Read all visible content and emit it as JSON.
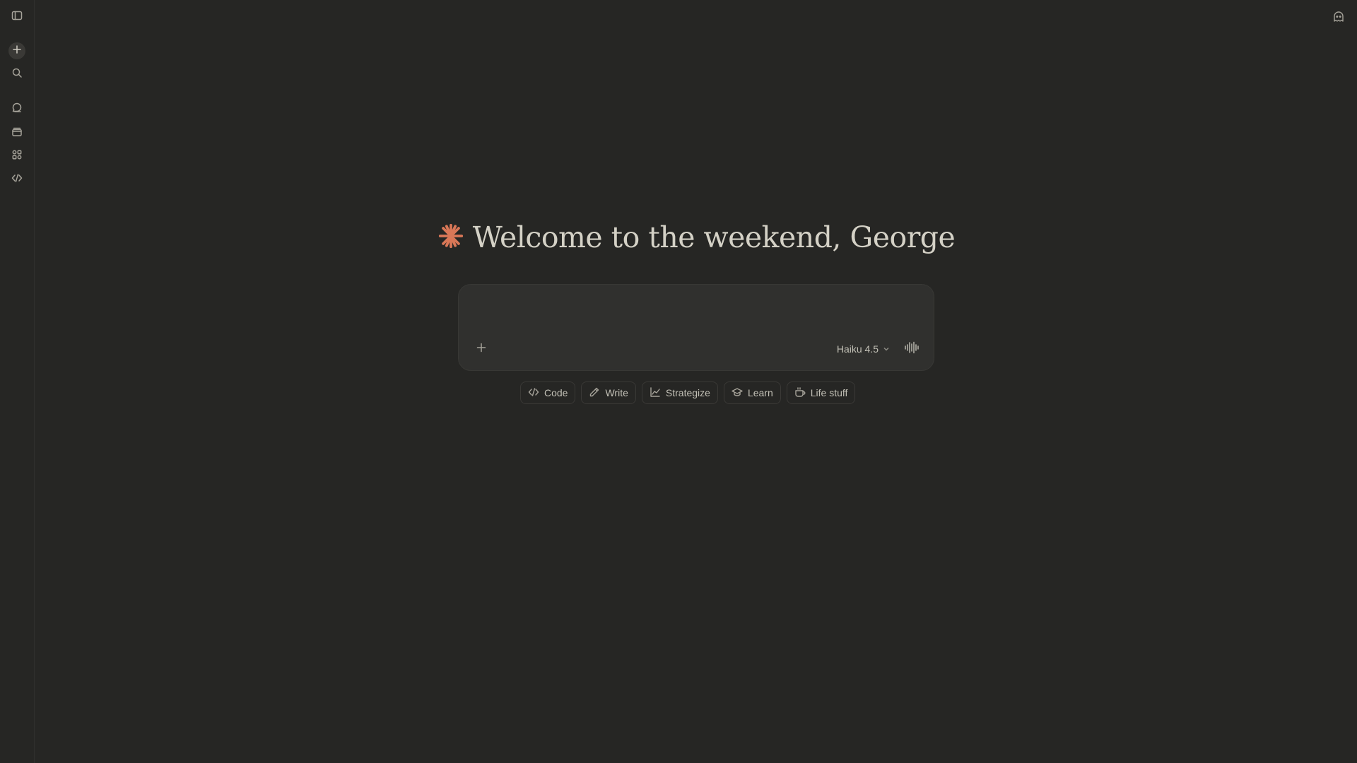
{
  "sidebar": {
    "items": [
      {
        "name": "toggle-sidebar",
        "icon": "sidebar-toggle-icon"
      },
      {
        "name": "new-chat",
        "icon": "plus-icon"
      },
      {
        "name": "search",
        "icon": "search-icon"
      },
      {
        "name": "chats",
        "icon": "chat-bubble-icon"
      },
      {
        "name": "projects",
        "icon": "folder-stack-icon"
      },
      {
        "name": "artifacts",
        "icon": "grid-shapes-icon"
      },
      {
        "name": "code",
        "icon": "code-icon"
      }
    ]
  },
  "header": {
    "right_icon": "ghost-icon"
  },
  "greeting": {
    "text": "Welcome to the weekend, George",
    "spark_color": "#d97757"
  },
  "composer": {
    "placeholder": "",
    "value": "",
    "model_label": "Haiku 4.5",
    "add_icon": "plus-icon",
    "voice_icon": "voice-waveform-icon"
  },
  "chips": [
    {
      "label": "Code",
      "icon": "code-icon"
    },
    {
      "label": "Write",
      "icon": "pencil-icon"
    },
    {
      "label": "Strategize",
      "icon": "line-chart-icon"
    },
    {
      "label": "Learn",
      "icon": "graduation-cap-icon"
    },
    {
      "label": "Life stuff",
      "icon": "coffee-cup-icon"
    }
  ]
}
